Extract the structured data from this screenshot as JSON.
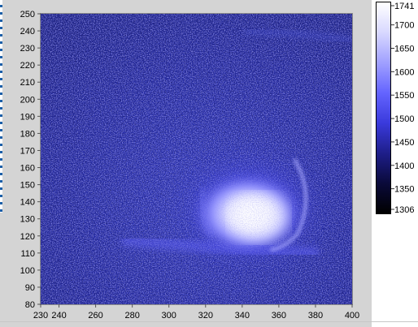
{
  "plot": {
    "x_ticks": [
      230,
      240,
      260,
      280,
      300,
      320,
      340,
      360,
      380,
      400
    ],
    "x_range": [
      230,
      400
    ],
    "y_ticks": [
      80,
      90,
      100,
      110,
      120,
      130,
      140,
      150,
      160,
      170,
      180,
      190,
      200,
      210,
      220,
      230,
      240,
      250
    ],
    "y_range": [
      80,
      250
    ]
  },
  "colorbar": {
    "ticks": [
      1306,
      1350,
      1400,
      1450,
      1500,
      1550,
      1600,
      1650,
      1700,
      1741
    ],
    "range": [
      1306,
      1741
    ],
    "colors": [
      "#000000",
      "#0a0a3a",
      "#1e1e8a",
      "#3a3adc",
      "#6464ff",
      "#a0a0ff",
      "#d8d8ff",
      "#ffffff"
    ]
  }
}
